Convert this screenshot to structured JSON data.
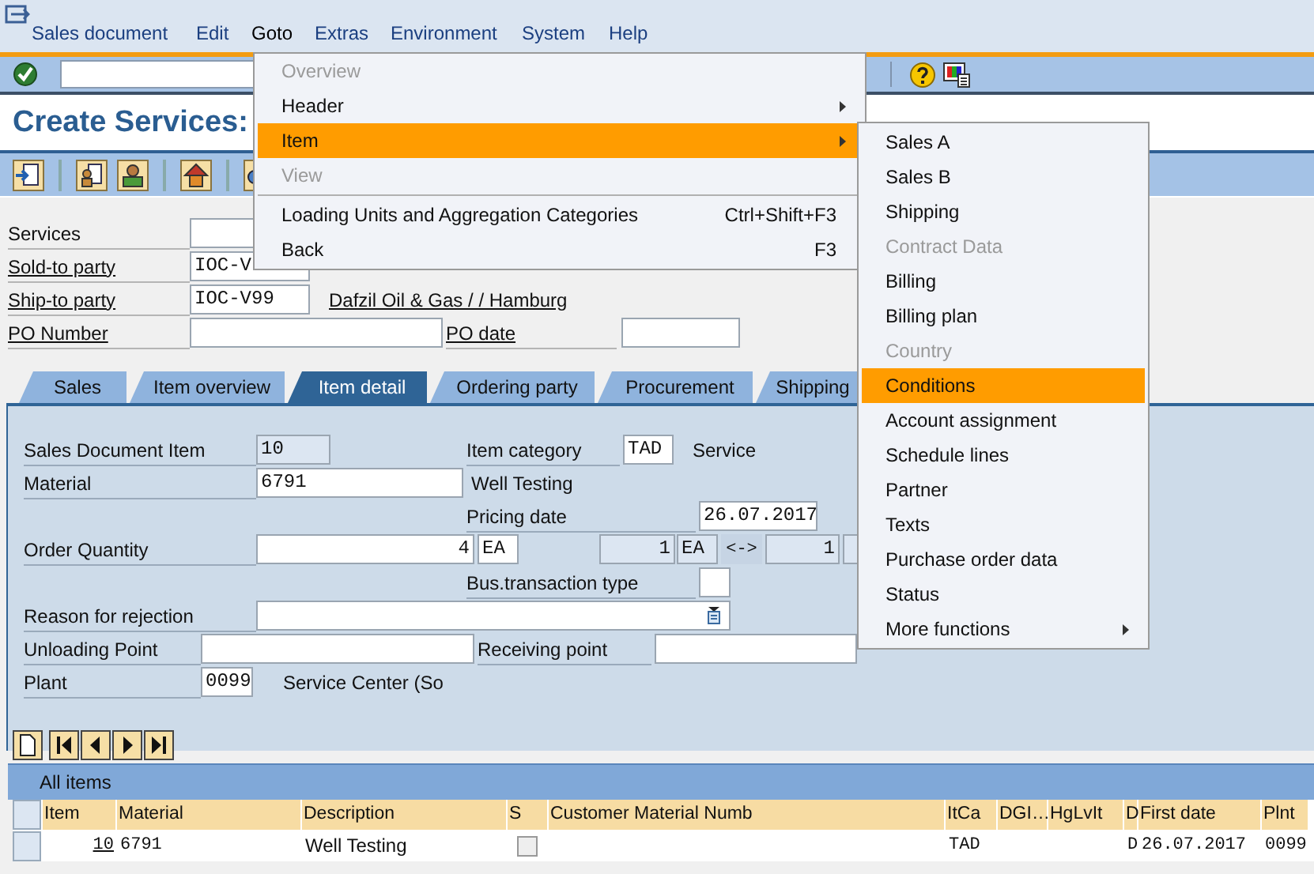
{
  "menu_bar": [
    {
      "label": "Sales document",
      "selected": false
    },
    {
      "label": "Edit",
      "selected": false
    },
    {
      "label": "Goto",
      "selected": true
    },
    {
      "label": "Extras",
      "selected": false
    },
    {
      "label": "Environment",
      "selected": false
    },
    {
      "label": "System",
      "selected": false
    },
    {
      "label": "Help",
      "selected": false
    }
  ],
  "title": "Create Services:",
  "header": {
    "services": {
      "label": "Services",
      "link": false
    },
    "sold_to": {
      "label": "Sold-to party",
      "link": true,
      "value": "IOC-V"
    },
    "ship_to": {
      "label": "Ship-to party",
      "link": true,
      "value": "IOC-V99",
      "description": "Dafzil Oil & Gas / / Hamburg",
      "description_link": true
    },
    "po_number": {
      "label": "PO Number",
      "link": true
    },
    "po_date": {
      "label": "PO date",
      "link": true
    }
  },
  "tabs": [
    {
      "label": "Sales",
      "selected": false
    },
    {
      "label": "Item overview",
      "selected": false
    },
    {
      "label": "Item detail",
      "selected": true
    },
    {
      "label": "Ordering party",
      "selected": false
    },
    {
      "label": "Procurement",
      "selected": false
    },
    {
      "label": "Shipping",
      "selected": false
    }
  ],
  "item_detail": {
    "sales_document_item": {
      "label": "Sales Document Item",
      "value": "10"
    },
    "item_category": {
      "label": "Item category",
      "value": "TAD",
      "description": "Service"
    },
    "material": {
      "label": "Material",
      "value": "6791",
      "description": "Well Testing"
    },
    "pricing_date": {
      "label": "Pricing date",
      "value": "26.07.2017"
    },
    "order_quantity": {
      "label": "Order Quantity",
      "value": "4",
      "unit": "EA",
      "base_quantity": "1",
      "base_unit": "EA",
      "arrow": "<->",
      "sales_quantity": "1"
    },
    "bus_transaction_type": {
      "label": "Bus.transaction type"
    },
    "reason_for_rejection": {
      "label": "Reason for rejection"
    },
    "unloading_point": {
      "label": "Unloading Point"
    },
    "receiving_point": {
      "label": "Receiving point"
    },
    "plant": {
      "label": "Plant",
      "value": "0099",
      "description": "Service Center (So"
    }
  },
  "items_table": {
    "title": "All items",
    "columns": [
      "Item",
      "Material",
      "Description",
      "S",
      "Customer Material Numb",
      "ItCa",
      "DGI…",
      "HgLvIt",
      "D",
      "First date",
      "Plnt"
    ],
    "rows": [
      {
        "item": "10",
        "material": "6791",
        "description": "Well Testing",
        "s_checked": false,
        "itca": "TAD",
        "d": "D",
        "first_date": "26.07.2017",
        "plnt": "0099"
      }
    ]
  },
  "goto_menu": [
    {
      "kind": "item",
      "label": "Overview",
      "disabled": true,
      "selected": false,
      "submenu": false
    },
    {
      "kind": "item",
      "label": "Header",
      "disabled": false,
      "selected": false,
      "submenu": true
    },
    {
      "kind": "item",
      "label": "Item",
      "disabled": false,
      "selected": true,
      "submenu": true
    },
    {
      "kind": "item",
      "label": "View",
      "disabled": true,
      "selected": false,
      "submenu": false
    },
    {
      "kind": "separator"
    },
    {
      "kind": "item",
      "label": "Loading Units and Aggregation Categories",
      "disabled": false,
      "selected": false,
      "submenu": false,
      "shortcut": "Ctrl+Shift+F3"
    },
    {
      "kind": "item",
      "label": "Back",
      "disabled": false,
      "selected": false,
      "submenu": false,
      "shortcut": "F3"
    }
  ],
  "item_submenu": [
    {
      "kind": "item",
      "label": "Sales A",
      "disabled": false,
      "selected": false,
      "submenu": false
    },
    {
      "kind": "item",
      "label": "Sales B",
      "disabled": false,
      "selected": false,
      "submenu": false
    },
    {
      "kind": "item",
      "label": "Shipping",
      "disabled": false,
      "selected": false,
      "submenu": false
    },
    {
      "kind": "item",
      "label": "Contract Data",
      "disabled": true,
      "selected": false,
      "submenu": false
    },
    {
      "kind": "item",
      "label": "Billing",
      "disabled": false,
      "selected": false,
      "submenu": false
    },
    {
      "kind": "item",
      "label": "Billing plan",
      "disabled": false,
      "selected": false,
      "submenu": false
    },
    {
      "kind": "item",
      "label": "Country",
      "disabled": true,
      "selected": false,
      "submenu": false
    },
    {
      "kind": "item",
      "label": "Conditions",
      "disabled": false,
      "selected": true,
      "submenu": false
    },
    {
      "kind": "item",
      "label": "Account assignment",
      "disabled": false,
      "selected": false,
      "submenu": false
    },
    {
      "kind": "item",
      "label": "Schedule lines",
      "disabled": false,
      "selected": false,
      "submenu": false
    },
    {
      "kind": "item",
      "label": "Partner",
      "disabled": false,
      "selected": false,
      "submenu": false
    },
    {
      "kind": "item",
      "label": "Texts",
      "disabled": false,
      "selected": false,
      "submenu": false
    },
    {
      "kind": "item",
      "label": "Purchase order data",
      "disabled": false,
      "selected": false,
      "submenu": false
    },
    {
      "kind": "item",
      "label": "Status",
      "disabled": false,
      "selected": false,
      "submenu": false
    },
    {
      "kind": "item",
      "label": "More functions",
      "disabled": false,
      "selected": false,
      "submenu": true
    }
  ]
}
